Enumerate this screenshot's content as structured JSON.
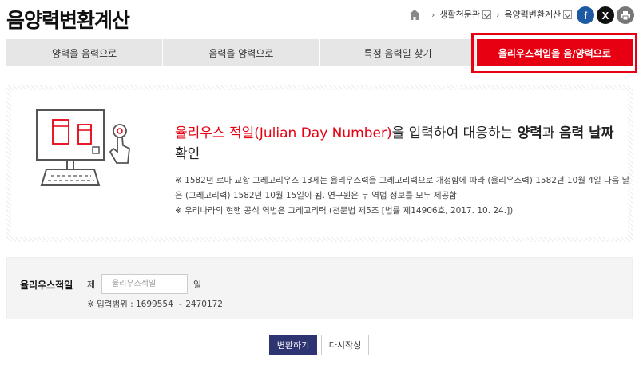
{
  "header": {
    "title": "음양력변환계산",
    "breadcrumb": [
      {
        "label": "생활천문관"
      },
      {
        "label": "음양력변환계산"
      }
    ],
    "social": {
      "facebook": "f",
      "x": "X",
      "print": "⎙"
    }
  },
  "tabs": [
    {
      "label": "양력을 음력으로",
      "active": false
    },
    {
      "label": "음력을 양력으로",
      "active": false
    },
    {
      "label": "특정 음력일 찾기",
      "active": false
    },
    {
      "label": "율리우스적일을 음/양력으로",
      "active": true
    }
  ],
  "intro": {
    "headline_red": "율리우스 적일(Julian Day Number)",
    "headline_mid1": "을 입력하여 대응하는 ",
    "headline_b1": "양력",
    "headline_mid2": "과 ",
    "headline_b2": "음력 날짜",
    "headline_end": " 확인",
    "note1": "※ 1582년 로마 교황 그레고리우스 13세는 율리우스력을 그레고리력으로 개정함에 따라 (율리우스력) 1582년 10월 4일 다음 날은 (그레고리력) 1582년 10월 15일이 됨. 연구원은 두 역법 정보를 모두 제공함",
    "note2": "※ 우리나라의 현행 공식 역법은 그레고리력 (천문법 제5조 [법률 제14906호, 2017. 10. 24.])"
  },
  "form": {
    "label": "율리우스적일",
    "prefix": "제",
    "placeholder": "율리우스적일",
    "value": "",
    "suffix": "일",
    "range": "※ 입력범위 : 1699554 ~ 2470172"
  },
  "buttons": {
    "convert": "변환하기",
    "reset": "다시작성"
  },
  "colors": {
    "accent_red": "#e60012",
    "button_navy": "#2e3471",
    "facebook": "#1d5aa3"
  }
}
